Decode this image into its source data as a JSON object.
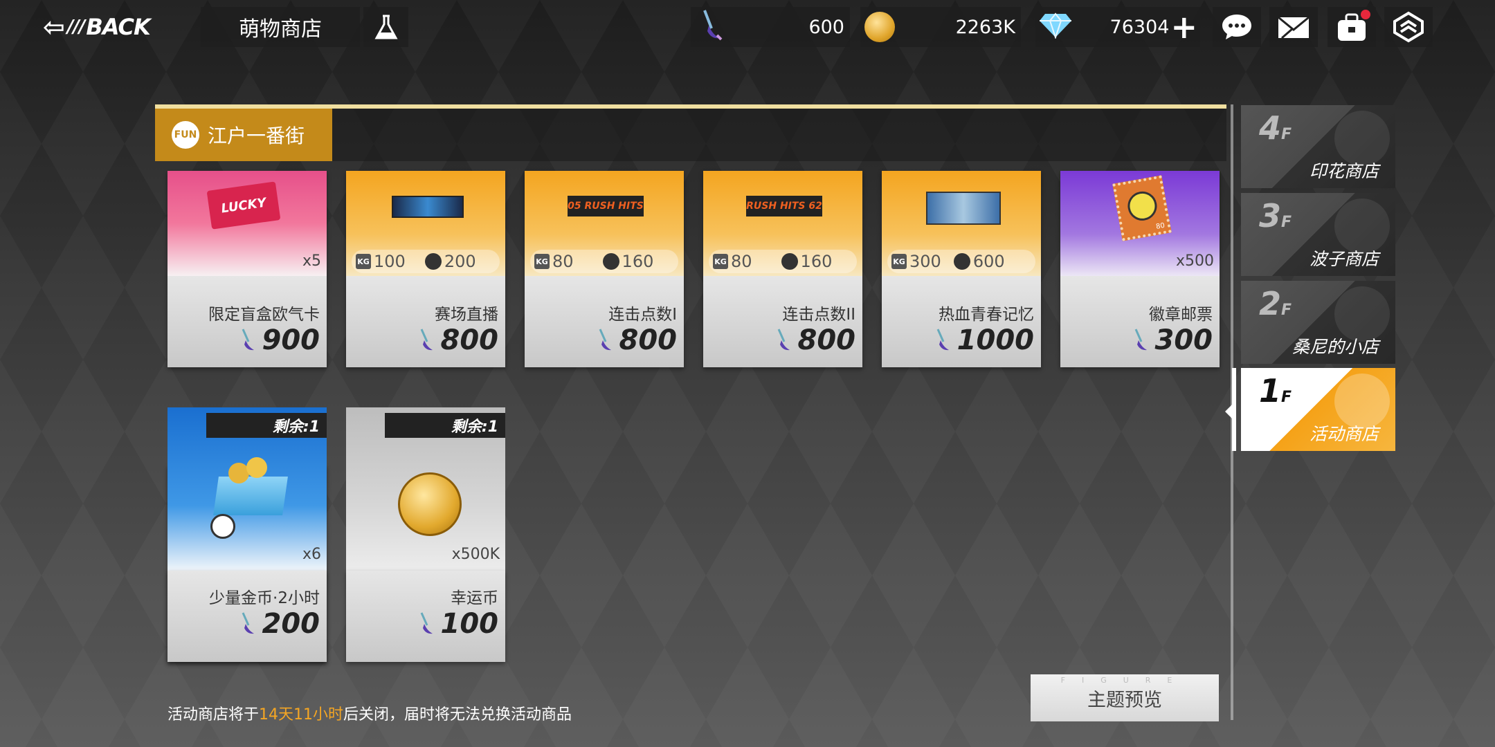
{
  "topbar": {
    "back_label": "BACK",
    "shop_title": "萌物商店",
    "resources": [
      {
        "icon": "brush-token-icon",
        "value": "600"
      },
      {
        "icon": "gold-coin-icon",
        "value": "2263K"
      },
      {
        "icon": "diamond-icon",
        "value": "76304"
      }
    ],
    "icons": [
      "chat-icon",
      "mail-icon",
      "bag-icon",
      "rank-icon"
    ]
  },
  "section": {
    "title": "江户一番街",
    "logo_text": "FUN"
  },
  "items": [
    {
      "name": "限定盲盒欧气卡",
      "price": "900",
      "qty": "x5",
      "style": "pink",
      "thumb": "LUCKY"
    },
    {
      "name": "赛场直播",
      "price": "800",
      "stat1": "100",
      "stat2": "200",
      "style": "orange",
      "thumb": ""
    },
    {
      "name": "连击点数I",
      "price": "800",
      "stat1": "80",
      "stat2": "160",
      "style": "orange",
      "thumb": "05 RUSH HITS"
    },
    {
      "name": "连击点数II",
      "price": "800",
      "stat1": "80",
      "stat2": "160",
      "style": "orange",
      "thumb": "RUSH HITS 62"
    },
    {
      "name": "热血青春记忆",
      "price": "1000",
      "stat1": "300",
      "stat2": "600",
      "style": "orange",
      "thumb": ""
    },
    {
      "name": "徽章邮票",
      "price": "300",
      "qty": "x500",
      "style": "purple",
      "thumb": "80"
    },
    {
      "name": "少量金币·2小时",
      "price": "200",
      "qty": "x6",
      "style": "blue",
      "remain": "剩余:1"
    },
    {
      "name": "幸运币",
      "price": "100",
      "qty": "x500K",
      "style": "grey",
      "remain": "剩余:1"
    }
  ],
  "floors": [
    {
      "num": "4",
      "suffix": "F",
      "label": "印花商店",
      "active": false
    },
    {
      "num": "3",
      "suffix": "F",
      "label": "波子商店",
      "active": false
    },
    {
      "num": "2",
      "suffix": "F",
      "label": "桑尼的小店",
      "active": false
    },
    {
      "num": "1",
      "suffix": "F",
      "label": "活动商店",
      "active": true
    }
  ],
  "footer": {
    "notice_prefix": "活动商店将于",
    "notice_time": "14天11小时",
    "notice_suffix": "后关闭，届时将无法兑换活动商品",
    "preview_button": "主题预览",
    "preview_watermark": "FIGURE"
  },
  "colors": {
    "accent": "#f5a623",
    "section_tab": "#c48a1a"
  }
}
